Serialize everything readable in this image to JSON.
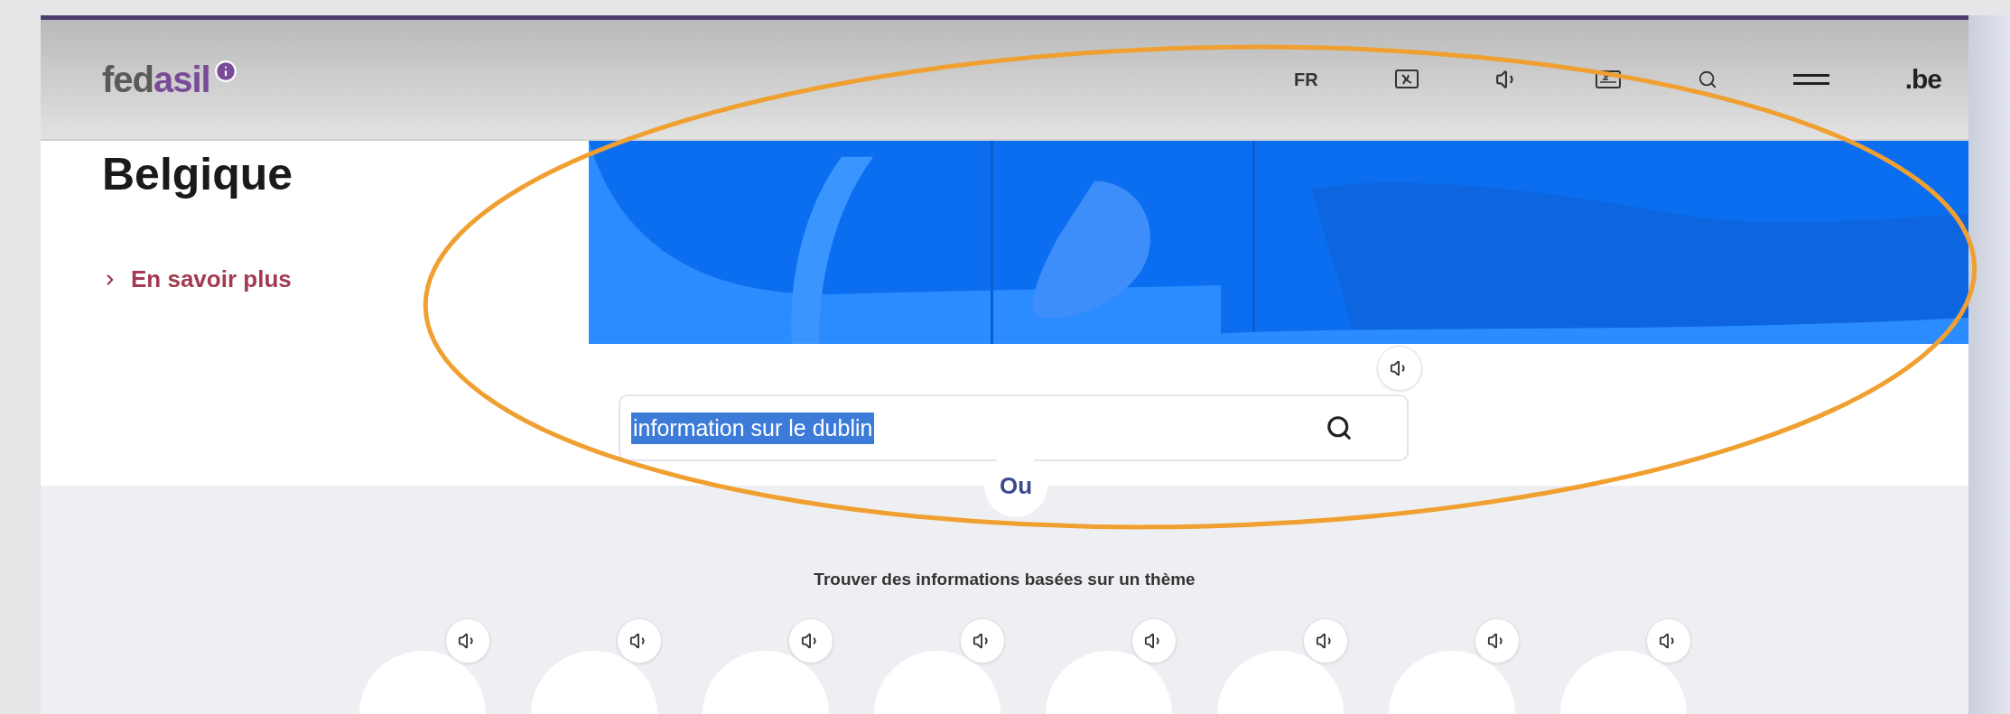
{
  "header": {
    "logo": {
      "prefix": "fed",
      "suffix": "asil"
    },
    "language": "FR",
    "gov_mark": ".be"
  },
  "hero": {
    "title": "Belgique",
    "link": "En savoir plus"
  },
  "search": {
    "value": "information sur le dublin",
    "highlighted": true,
    "audio_button": true
  },
  "separator": "Ou",
  "themes_heading": "Trouver des informations basées sur un thème",
  "themes": [
    {
      "audio_button": true
    },
    {
      "audio_button": true
    },
    {
      "audio_button": true
    },
    {
      "audio_button": true
    },
    {
      "audio_button": true
    },
    {
      "audio_button": true
    },
    {
      "audio_button": true
    },
    {
      "audio_button": true
    }
  ],
  "annotation": {
    "kind": "ellipse",
    "color": "#f0a030"
  }
}
